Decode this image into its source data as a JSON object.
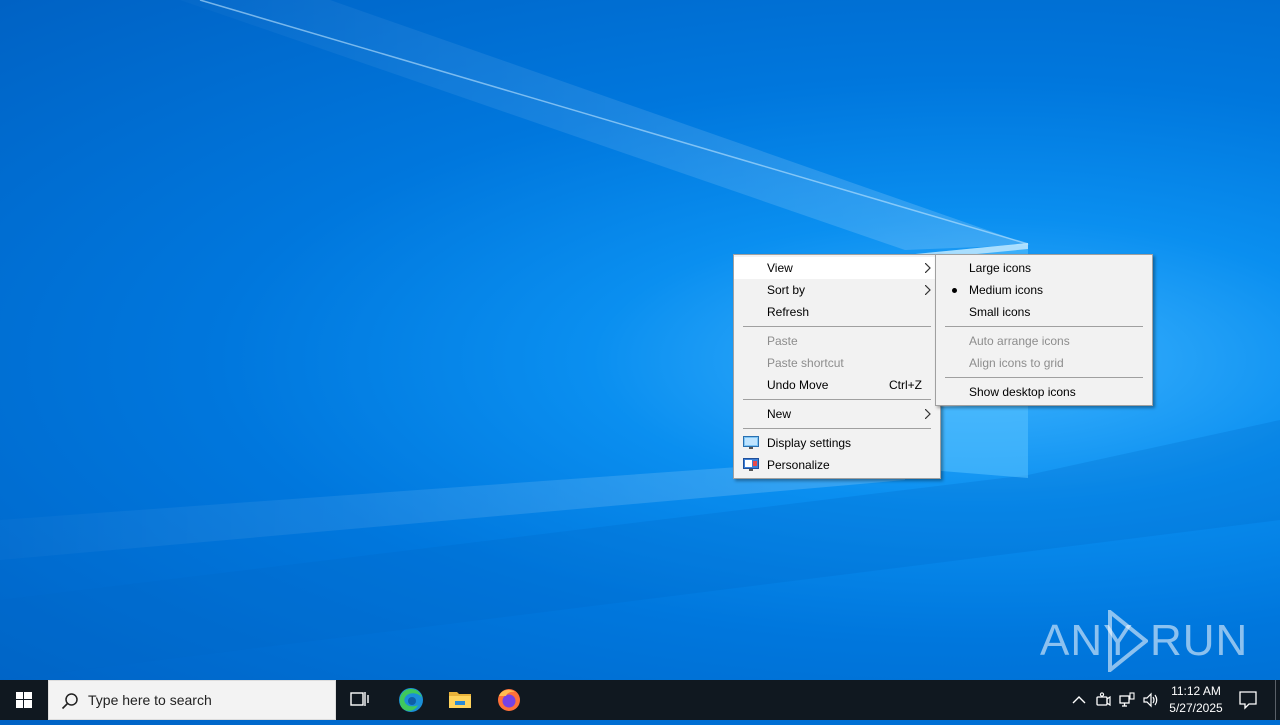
{
  "context_menu": {
    "items": [
      {
        "label": "View"
      },
      {
        "label": "Sort by"
      },
      {
        "label": "Refresh"
      },
      {
        "label": "Paste"
      },
      {
        "label": "Paste shortcut"
      },
      {
        "label": "Undo Move",
        "shortcut": "Ctrl+Z"
      },
      {
        "label": "New"
      },
      {
        "label": "Display settings",
        "icon": "display-settings-icon"
      },
      {
        "label": "Personalize",
        "icon": "personalize-icon"
      }
    ]
  },
  "view_submenu": {
    "items": [
      {
        "label": "Large icons"
      },
      {
        "label": "Medium icons",
        "selected": true
      },
      {
        "label": "Small icons"
      },
      {
        "label": "Auto arrange icons"
      },
      {
        "label": "Align icons to grid"
      },
      {
        "label": "Show desktop icons"
      }
    ]
  },
  "watermark": {
    "left": "ANY",
    "right": "RUN"
  },
  "taskbar": {
    "search_placeholder": "Type here to search",
    "apps": [
      "task-view-icon",
      "edge-icon",
      "file-explorer-icon",
      "firefox-icon"
    ],
    "tray_icons": [
      "chevron-up-icon",
      "meet-now-icon",
      "network-icon",
      "volume-icon"
    ],
    "clock_time": "11:12 AM",
    "clock_date": "5/27/2025"
  },
  "colors": {
    "desktop_blue": "#0078d7",
    "taskbar": "#101820",
    "menu_bg": "#f2f2f2"
  }
}
